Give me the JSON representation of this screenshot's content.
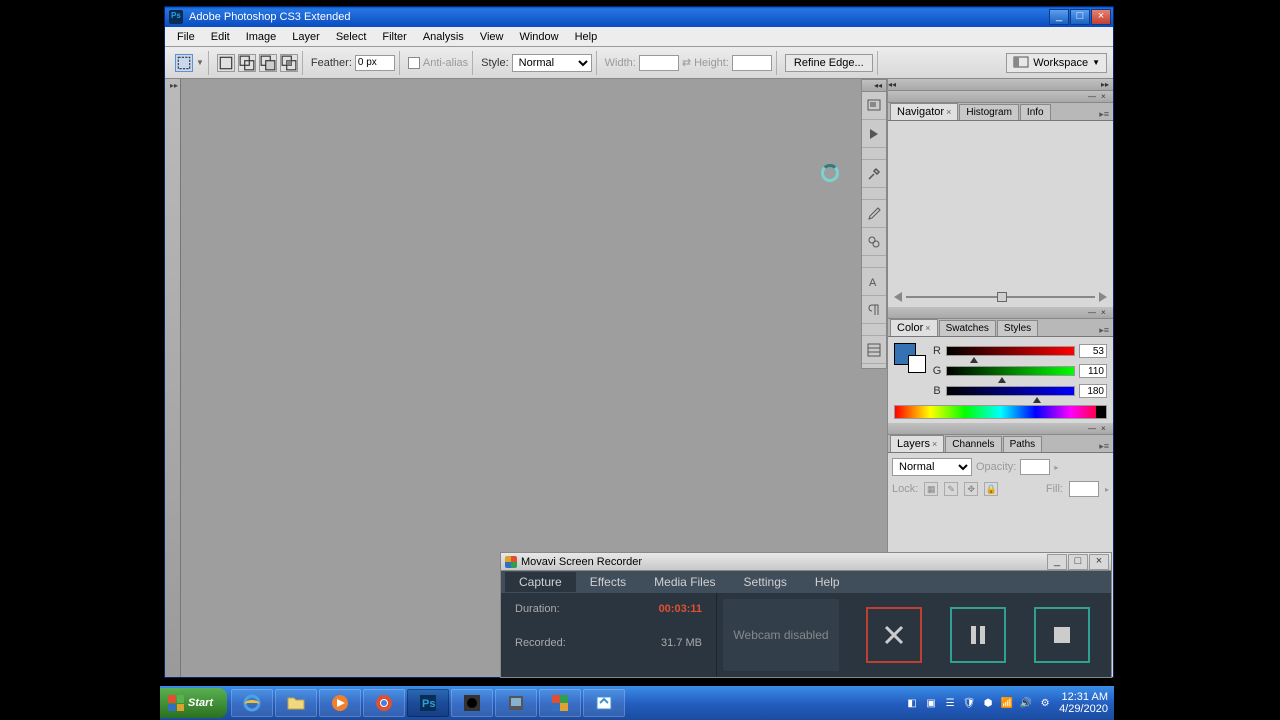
{
  "photoshop": {
    "title": "Adobe Photoshop CS3 Extended",
    "menu": [
      "File",
      "Edit",
      "Image",
      "Layer",
      "Select",
      "Filter",
      "Analysis",
      "View",
      "Window",
      "Help"
    ],
    "options": {
      "feather_label": "Feather:",
      "feather_value": "0 px",
      "antialias_label": "Anti-alias",
      "style_label": "Style:",
      "style_value": "Normal",
      "width_label": "Width:",
      "width_value": "",
      "height_label": "Height:",
      "height_value": "",
      "refine_label": "Refine Edge...",
      "workspace_label": "Workspace"
    },
    "tools": [
      "move",
      "marquee",
      "lasso",
      "wand",
      "crop",
      "slice",
      "healing",
      "brush",
      "stamp",
      "history-brush",
      "eraser",
      "gradient",
      "blur",
      "dodge",
      "pen",
      "type",
      "path-select",
      "line",
      "notes",
      "eyedropper",
      "hand",
      "zoom"
    ],
    "panels": {
      "navigator": {
        "tabs": [
          "Navigator",
          "Histogram",
          "Info"
        ],
        "active": 0
      },
      "color": {
        "tabs": [
          "Color",
          "Swatches",
          "Styles"
        ],
        "active": 0,
        "r": 53,
        "g": 110,
        "b": 180
      },
      "layers": {
        "tabs": [
          "Layers",
          "Channels",
          "Paths"
        ],
        "active": 0,
        "blend": "Normal",
        "opacity_label": "Opacity:",
        "opacity": "",
        "lock_label": "Lock:",
        "fill_label": "Fill:",
        "fill": ""
      }
    }
  },
  "movavi": {
    "title": "Movavi Screen Recorder",
    "menu": [
      "Capture",
      "Effects",
      "Media Files",
      "Settings",
      "Help"
    ],
    "duration_label": "Duration:",
    "duration": "00:03:11",
    "recorded_label": "Recorded:",
    "recorded": "31.7 MB",
    "webcam": "Webcam disabled"
  },
  "taskbar": {
    "start": "Start",
    "time": "12:31 AM",
    "date": "4/29/2020"
  }
}
